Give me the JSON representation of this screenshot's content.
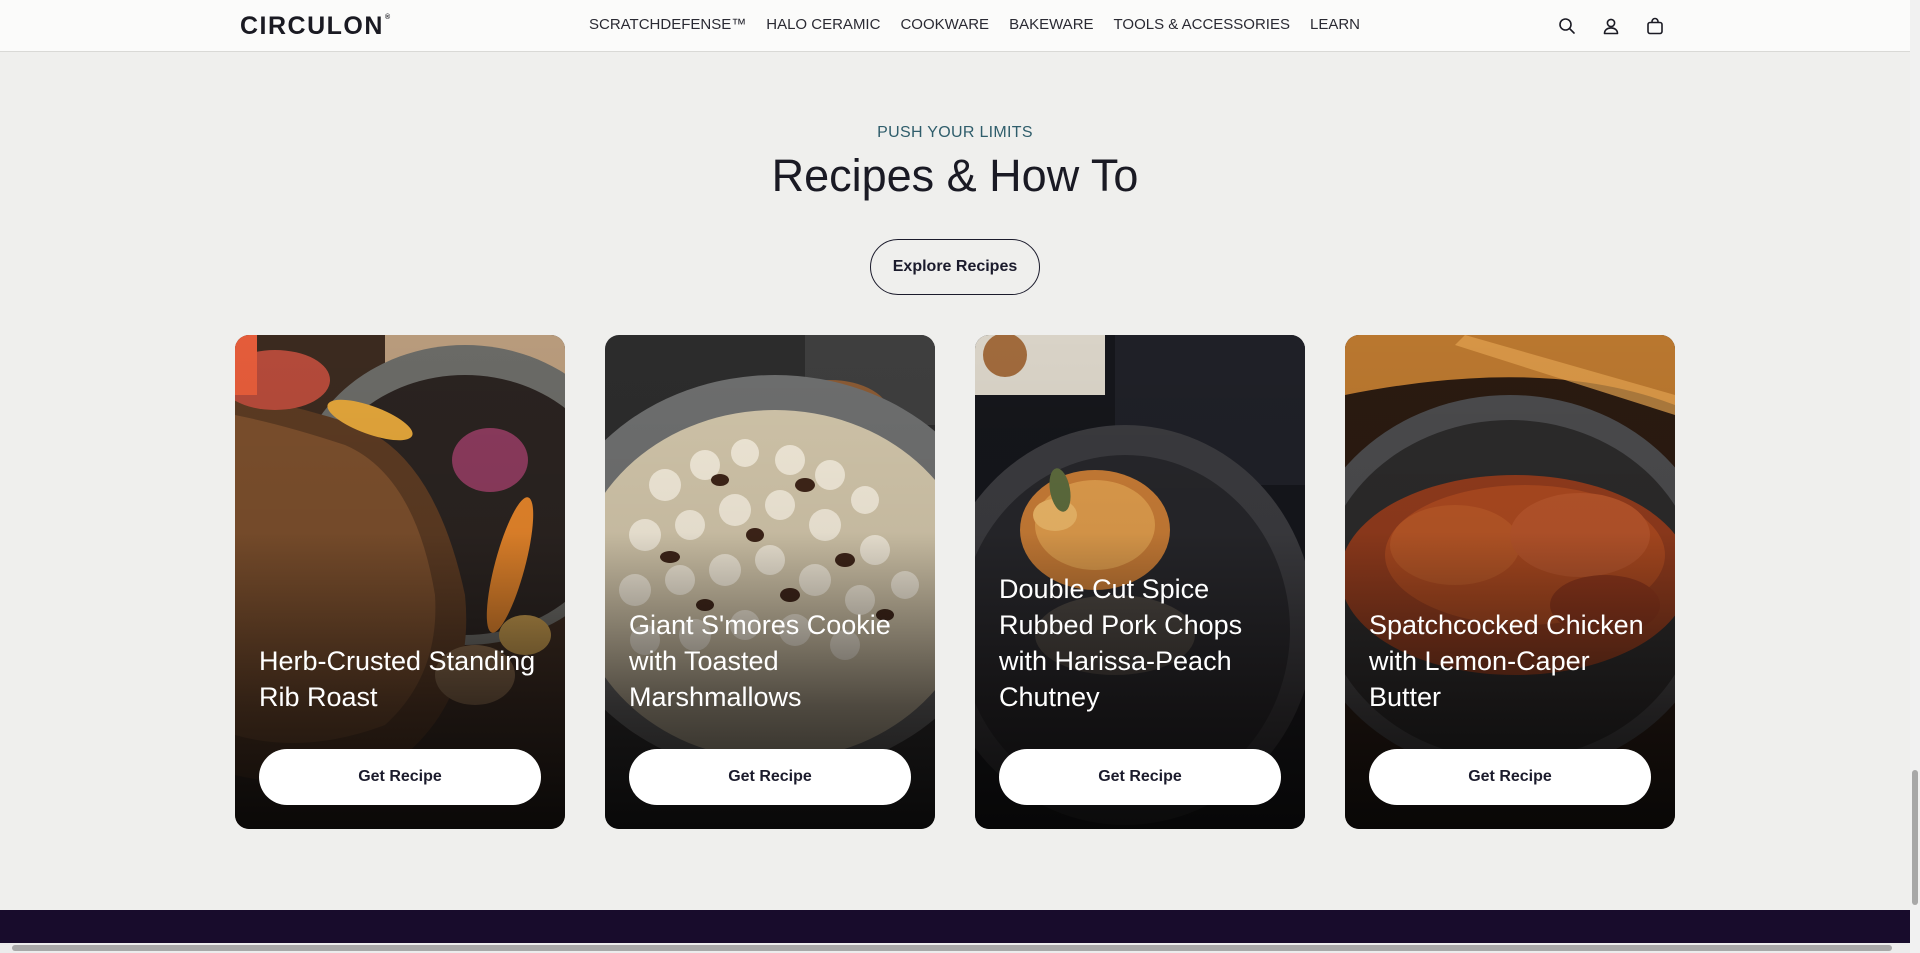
{
  "header": {
    "logo": "CIRCULON",
    "logo_mark": "®",
    "nav": [
      "SCRATCHDEFENSE™",
      "HALO CERAMIC",
      "COOKWARE",
      "BAKEWARE",
      "TOOLS & ACCESSORIES",
      "LEARN"
    ],
    "icons": [
      "search-icon",
      "account-icon",
      "cart-icon"
    ]
  },
  "section": {
    "eyebrow": "PUSH YOUR LIMITS",
    "title": "Recipes & How To",
    "cta": "Explore Recipes"
  },
  "cards": [
    {
      "title": "Herb-Crusted Standing Rib Roast",
      "button": "Get Recipe"
    },
    {
      "title": "Giant S'mores Cookie with Toasted Marshmallows",
      "button": "Get Recipe"
    },
    {
      "title": "Double Cut Spice Rubbed Pork Chops with Harissa-Peach Chutney",
      "button": "Get Recipe"
    },
    {
      "title": "Spatchcocked Chicken with Lemon-Caper Butter",
      "button": "Get Recipe"
    }
  ],
  "colors": {
    "background": "#efefed",
    "eyebrow": "#2f5d6b",
    "footer": "#180c2c"
  }
}
